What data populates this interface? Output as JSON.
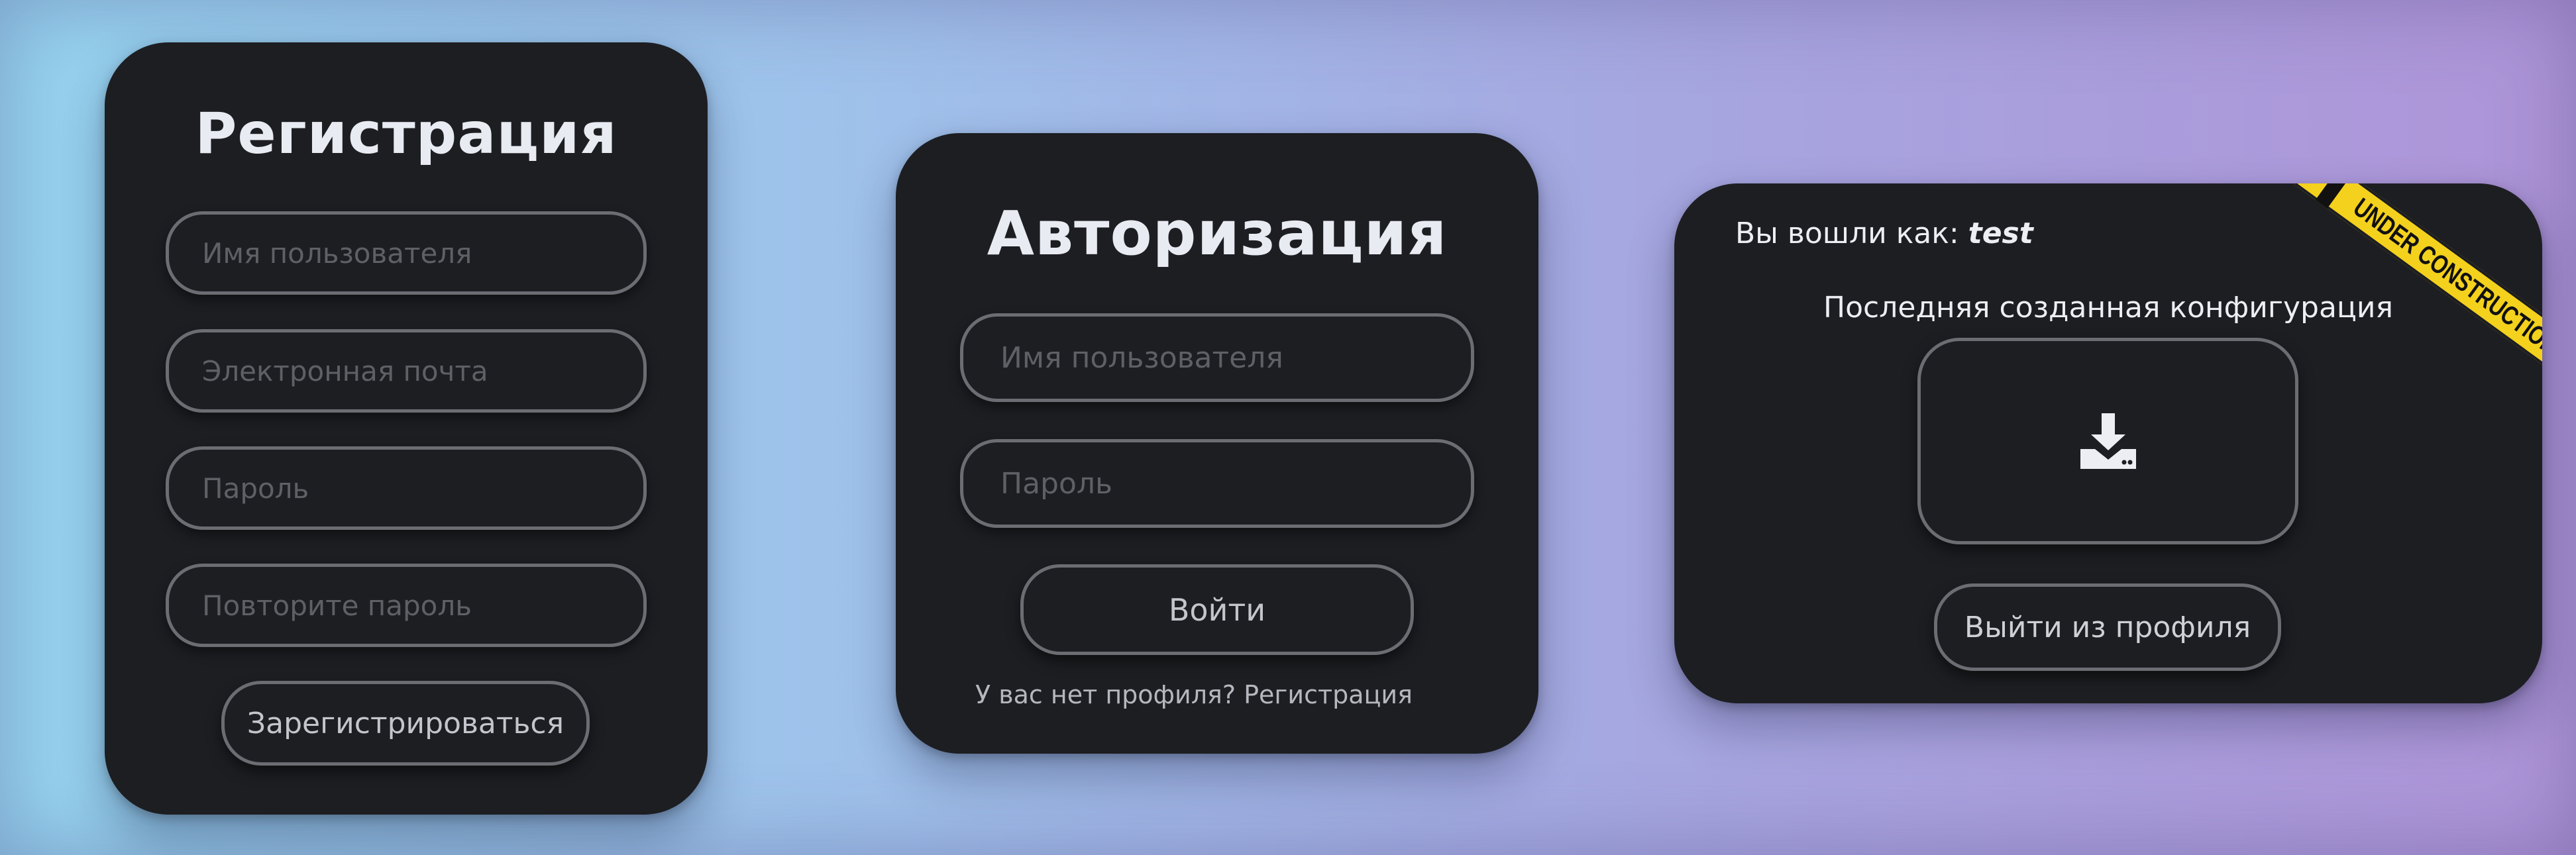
{
  "register": {
    "title": "Регистрация",
    "username_placeholder": "Имя пользователя",
    "email_placeholder": "Электронная почта",
    "password_placeholder": "Пароль",
    "repeat_password_placeholder": "Повторите пароль",
    "submit_label": "Зарегистрироваться"
  },
  "login": {
    "title": "Авторизация",
    "username_placeholder": "Имя пользователя",
    "password_placeholder": "Пароль",
    "submit_label": "Войти",
    "no_profile_text": "У вас нет профиля?",
    "register_link": "Регистрация"
  },
  "profile": {
    "logged_in_as_label": "Вы вошли как:",
    "username": "test",
    "last_config_label": "Последняя созданная конфигурация",
    "download_icon": "download-icon",
    "logout_label": "Выйти из профиля",
    "ribbon_text": "UNDER CONSTRUCTION",
    "ribbon_color": "#f4d11c"
  },
  "colors": {
    "card_bg": "#1d1e22",
    "border": "#6c6d73",
    "title": "#e8ebf2"
  }
}
